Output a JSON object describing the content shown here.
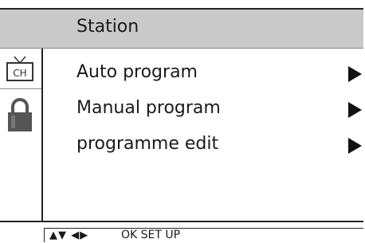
{
  "header": {
    "title": "Station"
  },
  "menu": {
    "items": [
      {
        "label": "Auto program"
      },
      {
        "label": "Manual program"
      },
      {
        "label": "programme edit"
      }
    ]
  },
  "sidebar": {
    "icons": [
      {
        "name": "tv-channel-icon",
        "text": "CH"
      },
      {
        "name": "lock-icon"
      }
    ]
  },
  "footer": {
    "nav_glyphs": "▲▼ ◀▶",
    "hint": "OK SET UP"
  }
}
